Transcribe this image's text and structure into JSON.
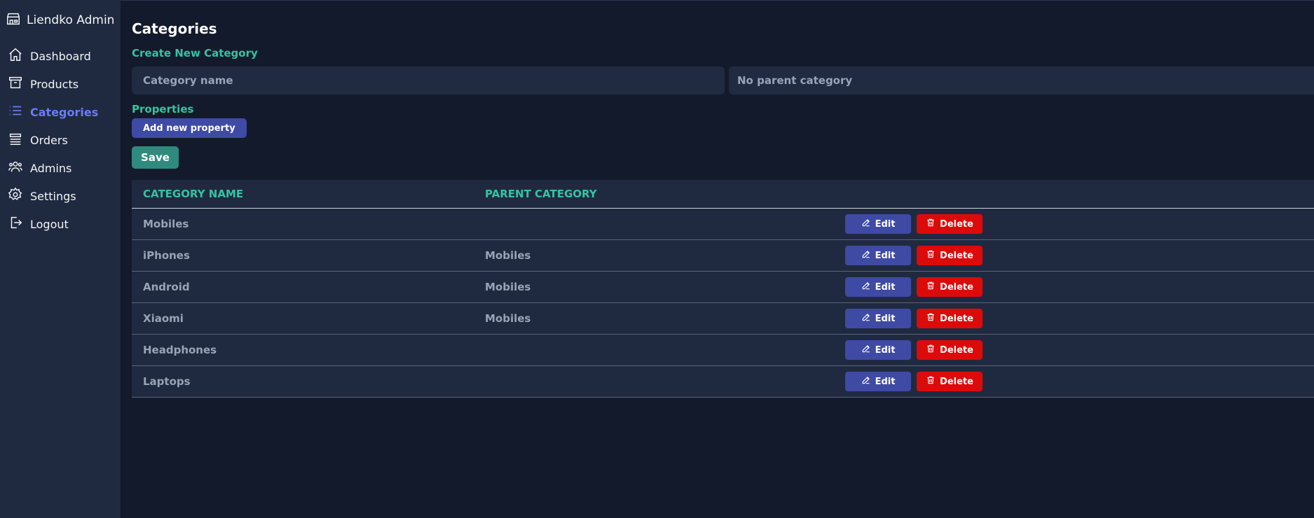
{
  "sidebar": {
    "brand": "Liendko Admin",
    "items": [
      {
        "label": "Dashboard",
        "icon": "home-icon"
      },
      {
        "label": "Products",
        "icon": "archive-box-icon"
      },
      {
        "label": "Categories",
        "icon": "list-icon",
        "active": true
      },
      {
        "label": "Orders",
        "icon": "queue-list-icon"
      },
      {
        "label": "Admins",
        "icon": "users-icon"
      },
      {
        "label": "Settings",
        "icon": "gear-icon"
      },
      {
        "label": "Logout",
        "icon": "logout-icon"
      }
    ]
  },
  "main": {
    "title": "Categories",
    "form": {
      "heading": "Create New Category",
      "name_placeholder": "Category name",
      "parent_selected": "No parent category",
      "properties_label": "Properties",
      "add_property_label": "Add new property",
      "save_label": "Save"
    },
    "table": {
      "headers": [
        "CATEGORY NAME",
        "PARENT CATEGORY"
      ],
      "edit_label": "Edit",
      "delete_label": "Delete",
      "rows": [
        {
          "name": "Mobiles",
          "parent": ""
        },
        {
          "name": "iPhones",
          "parent": "Mobiles"
        },
        {
          "name": "Android",
          "parent": "Mobiles"
        },
        {
          "name": "Xiaomi",
          "parent": "Mobiles"
        },
        {
          "name": "Headphones",
          "parent": ""
        },
        {
          "name": "Laptops",
          "parent": ""
        }
      ]
    }
  },
  "colors": {
    "accent": "#34c3a0",
    "active_nav": "#6b7cf5",
    "edit_button": "#3f4aa5",
    "delete_button": "#dd0a0a",
    "save_button": "#2f8b7d"
  }
}
